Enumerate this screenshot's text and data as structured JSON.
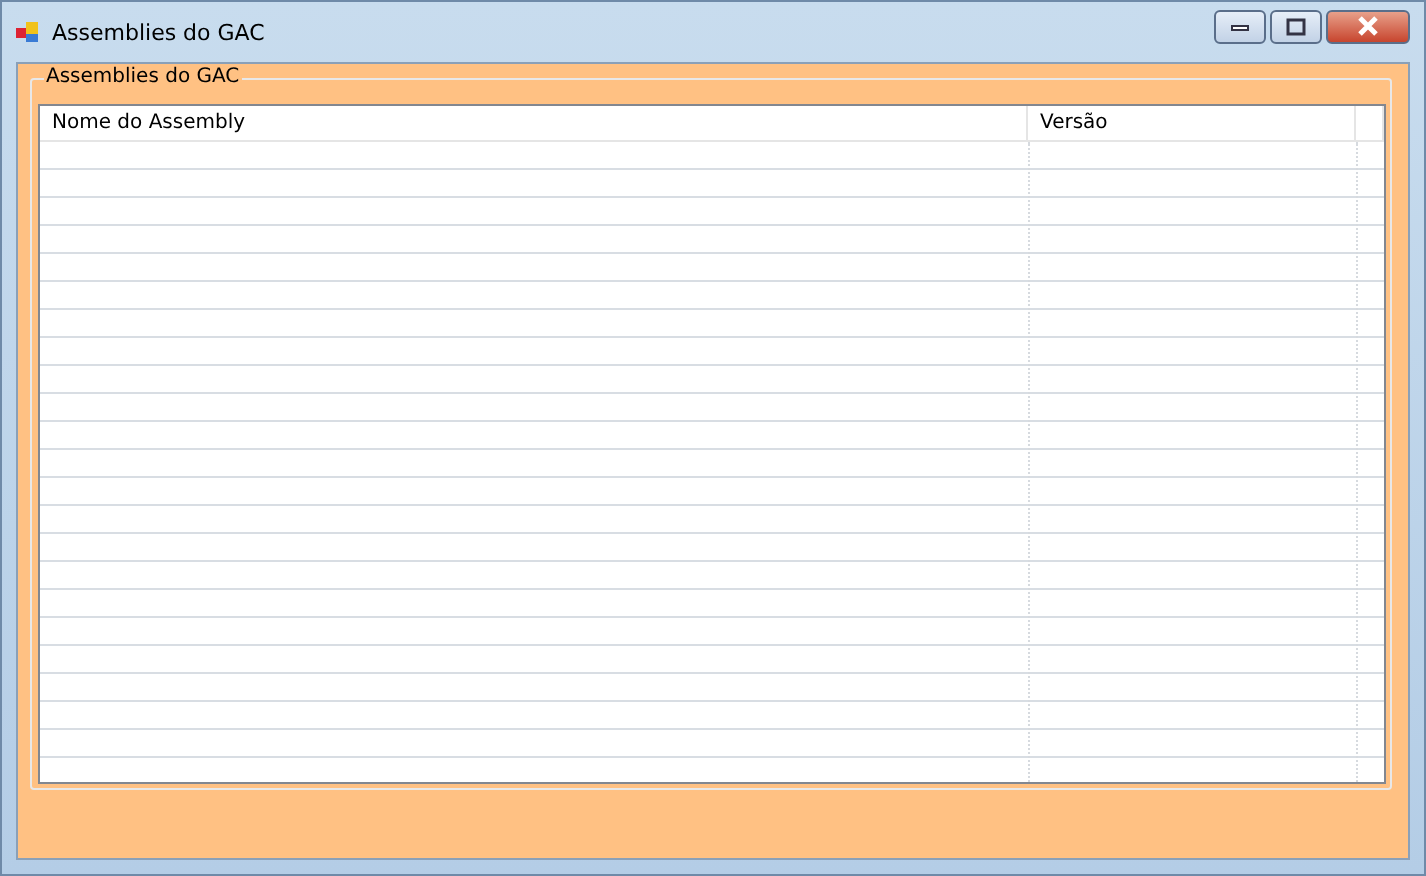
{
  "window": {
    "title": "Assemblies do GAC"
  },
  "group": {
    "title": "Assemblies do GAC"
  },
  "table": {
    "columns": [
      {
        "label": "Nome do Assembly"
      },
      {
        "label": "Versão"
      }
    ]
  }
}
